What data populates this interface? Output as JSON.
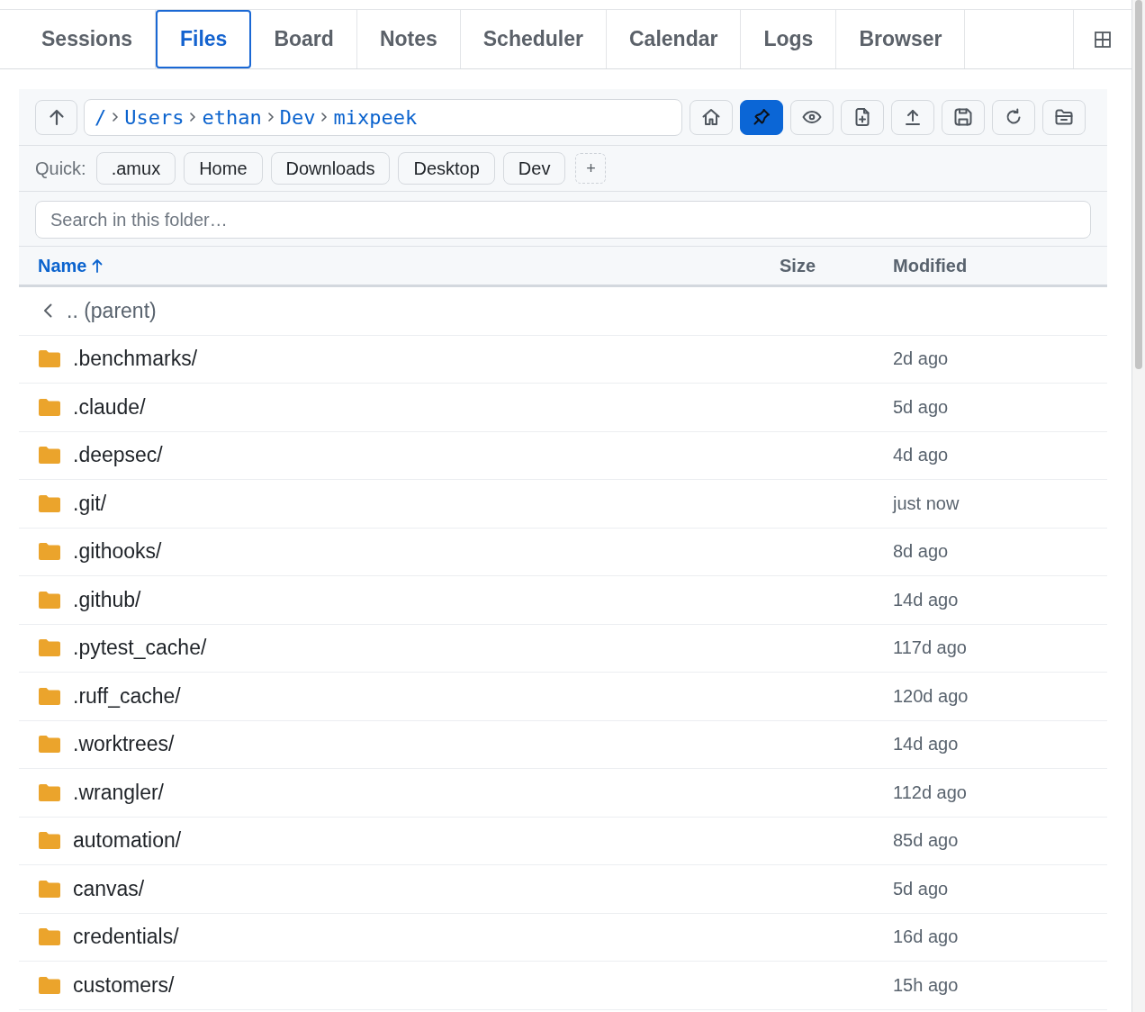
{
  "tabs": [
    {
      "label": "Sessions",
      "selected": false
    },
    {
      "label": "Files",
      "selected": true
    },
    {
      "label": "Board",
      "selected": false
    },
    {
      "label": "Notes",
      "selected": false
    },
    {
      "label": "Scheduler",
      "selected": false
    },
    {
      "label": "Calendar",
      "selected": false
    },
    {
      "label": "Logs",
      "selected": false
    },
    {
      "label": "Browser",
      "selected": false
    }
  ],
  "toolbar": {
    "breadcrumb": [
      "/",
      "Users",
      "ethan",
      "Dev",
      "mixpeek"
    ],
    "buttons": [
      {
        "kind": "home",
        "on": false
      },
      {
        "kind": "pin",
        "on": true
      },
      {
        "kind": "preview",
        "on": false
      },
      {
        "kind": "new_file",
        "on": false
      },
      {
        "kind": "upload",
        "on": false
      },
      {
        "kind": "save",
        "on": false
      },
      {
        "kind": "refresh",
        "on": false
      },
      {
        "kind": "new_folder",
        "on": false
      }
    ]
  },
  "quick_access": {
    "label": "Quick:",
    "chips": [
      ".amux",
      "Home",
      "Downloads",
      "Desktop",
      "Dev"
    ],
    "add_button": "+"
  },
  "search": {
    "placeholder": "Search in this folder…"
  },
  "table": {
    "columns": [
      {
        "label": "Name",
        "sorted": true
      },
      {
        "label": "Size",
        "sorted": false
      },
      {
        "label": "Modified",
        "sorted": false
      }
    ],
    "parent_row": {
      "label": ".. (parent)"
    },
    "rows": [
      {
        "kind": "folder",
        "name": ".benchmarks/",
        "modified": "2d ago"
      },
      {
        "kind": "folder",
        "name": ".claude/",
        "modified": "5d ago"
      },
      {
        "kind": "folder",
        "name": ".deepsec/",
        "modified": "4d ago"
      },
      {
        "kind": "folder",
        "name": ".git/",
        "modified": "just now"
      },
      {
        "kind": "folder",
        "name": ".githooks/",
        "modified": "8d ago"
      },
      {
        "kind": "folder",
        "name": ".github/",
        "modified": "14d ago"
      },
      {
        "kind": "folder",
        "name": ".pytest_cache/",
        "modified": "117d ago"
      },
      {
        "kind": "folder",
        "name": ".ruff_cache/",
        "modified": "120d ago"
      },
      {
        "kind": "folder",
        "name": ".worktrees/",
        "modified": "14d ago"
      },
      {
        "kind": "folder",
        "name": ".wrangler/",
        "modified": "112d ago"
      },
      {
        "kind": "folder",
        "name": "automation/",
        "modified": "85d ago"
      },
      {
        "kind": "folder",
        "name": "canvas/",
        "modified": "5d ago"
      },
      {
        "kind": "folder",
        "name": "credentials/",
        "modified": "16d ago"
      },
      {
        "kind": "folder",
        "name": "customers/",
        "modified": "15h ago"
      }
    ]
  }
}
